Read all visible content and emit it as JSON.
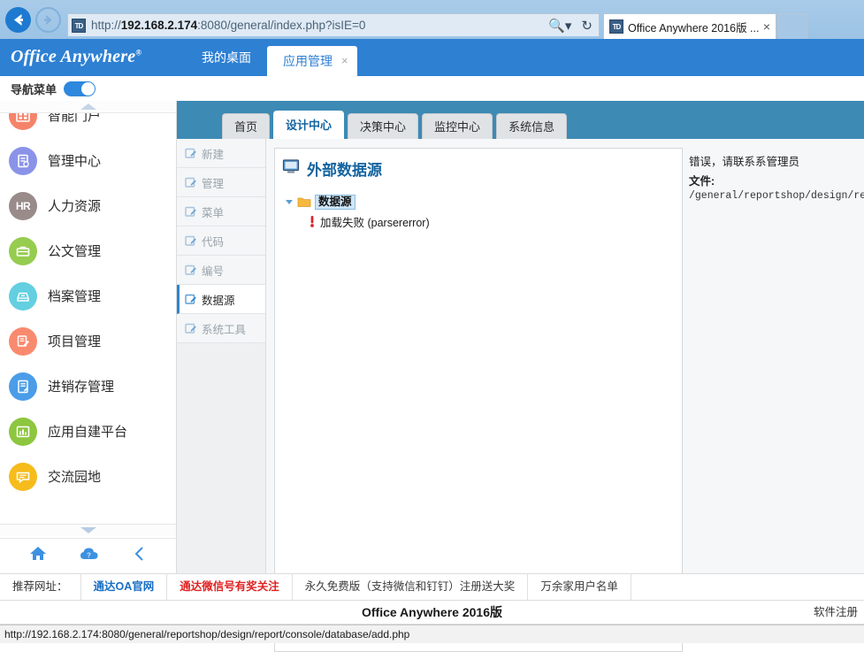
{
  "browser": {
    "favicon_label": "TD",
    "url_prefix": "http://",
    "url_host": "192.168.2.174",
    "url_rest": ":8080/general/index.php?isIE=0",
    "url_full": "http://192.168.2.174:8080/general/index.php?isIE=0",
    "search_icon": "search-dropdown-icon",
    "reload_icon": "reload-icon",
    "back_icon": "back-arrow-icon",
    "forward_icon": "forward-arrow-icon",
    "tab_title": "Office Anywhere 2016版 ...",
    "tab_close": "×"
  },
  "header": {
    "brand": "Office Anywhere",
    "brand_mark": "®",
    "tabs": [
      {
        "label": "我的桌面",
        "active": false,
        "closable": false
      },
      {
        "label": "应用管理",
        "active": true,
        "closable": true,
        "close": "×"
      }
    ]
  },
  "nav_toggle": {
    "label": "导航菜单",
    "state": "on"
  },
  "sidebar": {
    "scroll_up_icon": "scroll-up-arrow-icon",
    "scroll_down_icon": "scroll-down-arrow-icon",
    "items": [
      {
        "label": "智能门户",
        "icon": "portal-icon",
        "color": "#f5836a"
      },
      {
        "label": "管理中心",
        "icon": "admin-icon",
        "color": "#8a93e8"
      },
      {
        "label": "人力资源",
        "icon": "hr-icon",
        "color": "#9a8b8b",
        "text": "HR"
      },
      {
        "label": "公文管理",
        "icon": "document-icon",
        "color": "#96cc4f"
      },
      {
        "label": "档案管理",
        "icon": "archive-icon",
        "color": "#63cfe0"
      },
      {
        "label": "项目管理",
        "icon": "project-icon",
        "color": "#fa8a6e"
      },
      {
        "label": "进销存管理",
        "icon": "inventory-icon",
        "color": "#4b9de8"
      },
      {
        "label": "应用自建平台",
        "icon": "chart-icon",
        "color": "#8dc63f"
      },
      {
        "label": "交流园地",
        "icon": "forum-icon",
        "color": "#f5bc1c"
      }
    ],
    "footer_icons": [
      {
        "name": "home-icon",
        "color": "#3d91e0"
      },
      {
        "name": "cloud-help-icon",
        "color": "#3d91e0"
      },
      {
        "name": "collapse-left-icon",
        "color": "#3d91e0"
      }
    ]
  },
  "main": {
    "inner_tabs": [
      {
        "label": "首页",
        "active": false
      },
      {
        "label": "设计中心",
        "active": true
      },
      {
        "label": "决策中心",
        "active": false
      },
      {
        "label": "监控中心",
        "active": false
      },
      {
        "label": "系统信息",
        "active": false
      }
    ],
    "submenu": [
      {
        "label": "新建",
        "active": false,
        "icon": "edit-icon"
      },
      {
        "label": "管理",
        "active": false,
        "icon": "edit-icon"
      },
      {
        "label": "菜单",
        "active": false,
        "icon": "edit-icon"
      },
      {
        "label": "代码",
        "active": false,
        "icon": "edit-icon"
      },
      {
        "label": "编号",
        "active": false,
        "icon": "edit-icon"
      },
      {
        "label": "数据源",
        "active": true,
        "icon": "edit-icon"
      },
      {
        "label": "系统工具",
        "active": false,
        "icon": "edit-icon"
      }
    ],
    "tree": {
      "title": "外部数据源",
      "title_icon": "monitor-icon",
      "expand_icon": "tree-expand-arrow-icon",
      "folder_icon": "folder-icon",
      "root_label": "数据源",
      "error_icon": "error-marker-icon",
      "error_label": "加载失败 (parsererror)"
    },
    "error_panel": {
      "line1": "错误，请联系系管理员",
      "line2_label": "文件:",
      "line2_path": "/general/reportshop/design/report/console/database/add.php"
    }
  },
  "links_bar": {
    "prefix": "推荐网址：",
    "links": [
      {
        "label": "通达OA官网",
        "style": "blue"
      },
      {
        "label": "通达微信号有奖关注",
        "style": "red"
      },
      {
        "label": "永久免费版（支持微信和钉钉）注册送大奖",
        "style": "gray"
      },
      {
        "label": "万余家用户名单",
        "style": "gray"
      }
    ]
  },
  "footer": {
    "title": "Office Anywhere 2016版",
    "right_text": "软件注册"
  },
  "status_bar": {
    "text": "http://192.168.2.174:8080/general/reportshop/design/report/console/database/add.php"
  }
}
